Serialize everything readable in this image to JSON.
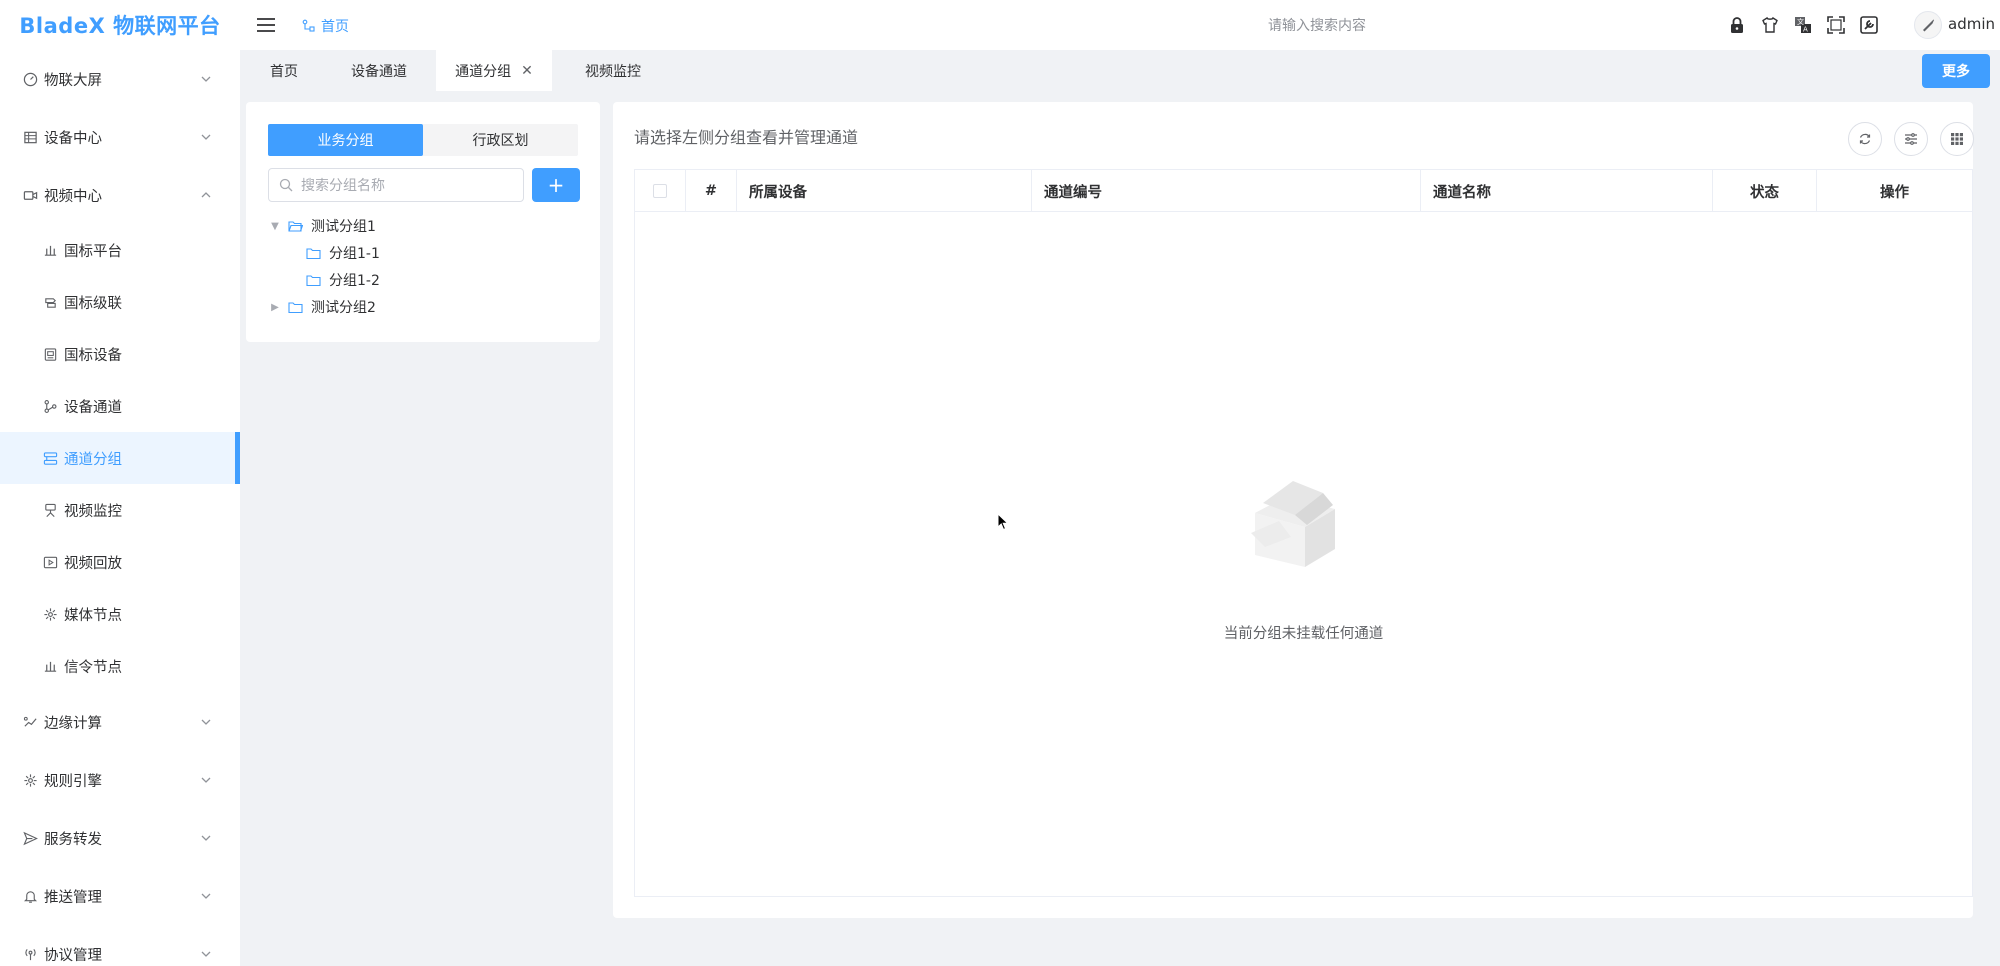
{
  "sidebar": {
    "logo": "BladeX 物联网平台",
    "groups_top": [
      {
        "label": "物联大屏",
        "icon": "dashboard-icon",
        "expanded": false
      },
      {
        "label": "设备中心",
        "icon": "device-center-icon",
        "expanded": false
      },
      {
        "label": "视频中心",
        "icon": "video-camera-icon",
        "expanded": true
      }
    ],
    "video_items": [
      {
        "label": "国标平台",
        "icon": "platform-icon"
      },
      {
        "label": "国标级联",
        "icon": "cascade-icon"
      },
      {
        "label": "国标设备",
        "icon": "device-icon"
      },
      {
        "label": "设备通道",
        "icon": "channel-icon"
      },
      {
        "label": "通道分组",
        "icon": "channel-group-icon",
        "active": true
      },
      {
        "label": "视频监控",
        "icon": "monitor-camera-icon"
      },
      {
        "label": "视频回放",
        "icon": "playback-icon"
      },
      {
        "label": "媒体节点",
        "icon": "media-node-icon"
      },
      {
        "label": "信令节点",
        "icon": "signal-node-icon"
      }
    ],
    "groups_bottom": [
      {
        "label": "边缘计算",
        "icon": "edge-compute-icon"
      },
      {
        "label": "规则引擎",
        "icon": "rule-engine-icon"
      },
      {
        "label": "服务转发",
        "icon": "send-icon"
      },
      {
        "label": "推送管理",
        "icon": "bell-icon"
      },
      {
        "label": "协议管理",
        "icon": "antenna-icon"
      }
    ]
  },
  "header": {
    "breadcrumb": "首页",
    "search_placeholder": "请输入搜索内容",
    "user": "admin",
    "icons": [
      "lock-icon",
      "theme-shirt-icon",
      "translate-icon",
      "fullscreen-icon",
      "settings-tool-icon"
    ]
  },
  "tabs": {
    "items": [
      {
        "label": "首页"
      },
      {
        "label": "设备通道"
      },
      {
        "label": "通道分组",
        "active": true,
        "closable": true
      },
      {
        "label": "视频监控"
      }
    ],
    "more": "更多"
  },
  "group_panel": {
    "segments": [
      "业务分组",
      "行政区划"
    ],
    "active_segment": 0,
    "search_placeholder": "搜索分组名称",
    "add_label": "+",
    "tree": [
      {
        "label": "测试分组1",
        "expanded": true,
        "children": [
          {
            "label": "分组1-1"
          },
          {
            "label": "分组1-2"
          }
        ]
      },
      {
        "label": "测试分组2",
        "expanded": false
      }
    ]
  },
  "channel_panel": {
    "title": "请选择左侧分组查看并管理通道",
    "columns": [
      "#",
      "所属设备",
      "通道编号",
      "通道名称",
      "状态",
      "操作"
    ],
    "empty_text": "当前分组未挂载任何通道"
  },
  "colors": {
    "primary": "#409eff",
    "active_bg": "#ecf5ff",
    "page_bg": "#f0f2f5"
  }
}
